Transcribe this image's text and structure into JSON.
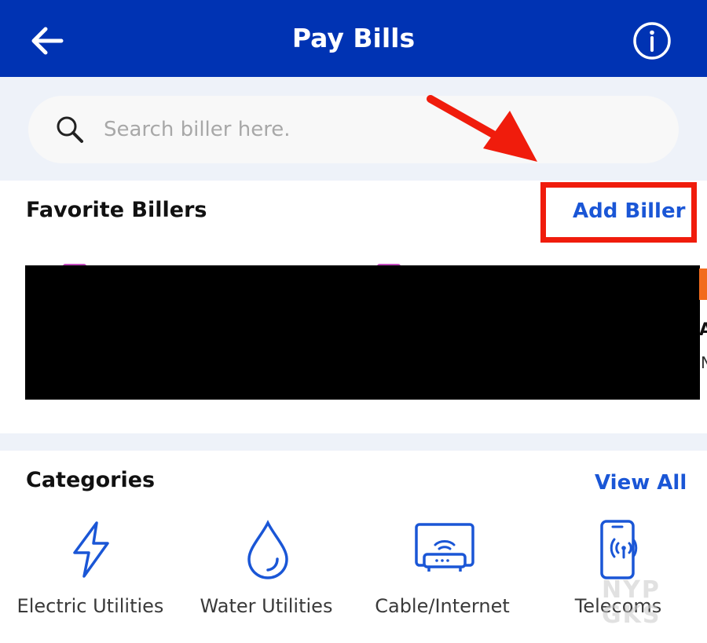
{
  "header": {
    "title": "Pay Bills",
    "back_icon": "arrow-left-icon",
    "info_icon": "info-circle-icon",
    "background_color": "#0033b3"
  },
  "search": {
    "placeholder": "Search biller here.",
    "value": "",
    "icon": "magnifier-icon"
  },
  "favorites": {
    "title": "Favorite Billers",
    "add_label": "Add Biller",
    "edge_text_1": "A",
    "edge_text_2": "N"
  },
  "categories": {
    "title": "Categories",
    "view_all_label": "View All",
    "items": [
      {
        "label": "Electric Utilities",
        "icon": "lightning-icon"
      },
      {
        "label": "Water Utilities",
        "icon": "water-drop-icon"
      },
      {
        "label": "Cable/Internet",
        "icon": "router-icon"
      },
      {
        "label": "Telecoms",
        "icon": "mobile-phone-icon"
      }
    ]
  },
  "annotation": {
    "arrow_color": "#f01c0c",
    "highlight_color": "#f01c0c"
  },
  "watermark": {
    "line1": "NYP",
    "line2": "GKS"
  },
  "colors": {
    "accent": "#1a56d6",
    "band": "#eef2f9"
  }
}
